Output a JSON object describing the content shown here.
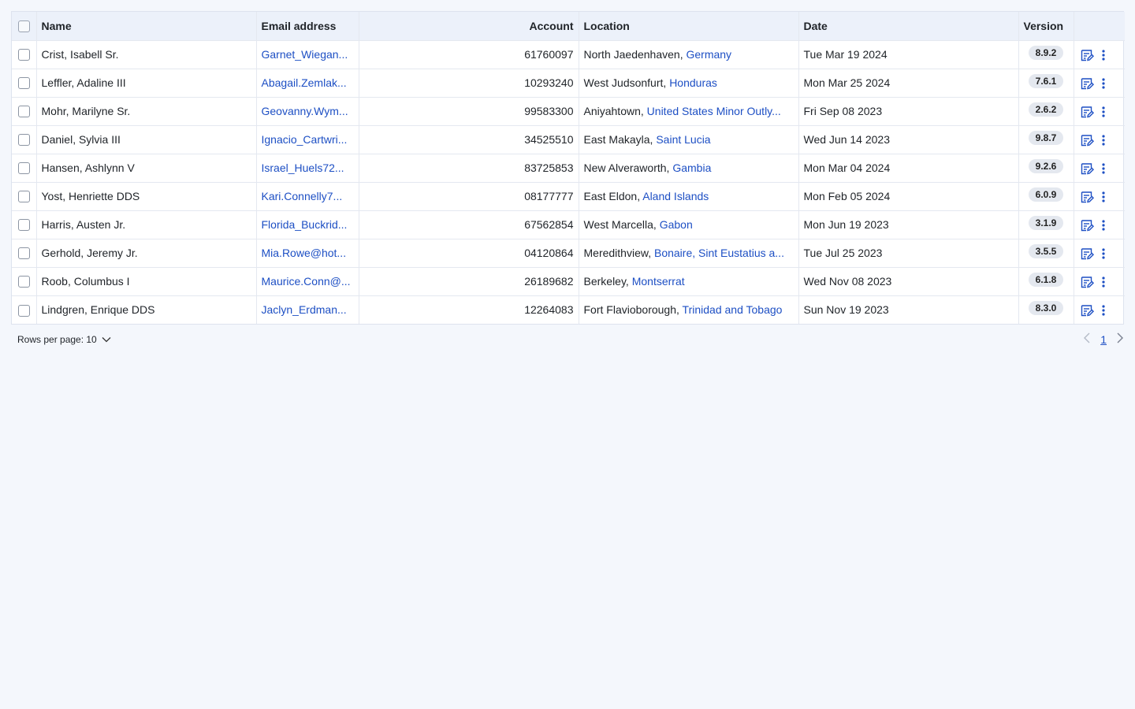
{
  "table": {
    "headers": {
      "name": "Name",
      "email": "Email address",
      "account": "Account",
      "location": "Location",
      "date": "Date",
      "version": "Version"
    },
    "rows": [
      {
        "name": "Crist, Isabell Sr.",
        "email": "Garnet_Wiegan...",
        "account": "61760097",
        "city": "North Jaedenhaven,",
        "country": "Germany",
        "date": "Tue Mar 19 2024",
        "version": "8.9.2"
      },
      {
        "name": "Leffler, Adaline III",
        "email": "Abagail.Zemlak...",
        "account": "10293240",
        "city": "West Judsonfurt,",
        "country": "Honduras",
        "date": "Mon Mar 25 2024",
        "version": "7.6.1"
      },
      {
        "name": "Mohr, Marilyne Sr.",
        "email": "Geovanny.Wym...",
        "account": "99583300",
        "city": "Aniyahtown,",
        "country": "United States Minor Outly...",
        "date": "Fri Sep 08 2023",
        "version": "2.6.2"
      },
      {
        "name": "Daniel, Sylvia III",
        "email": "Ignacio_Cartwri...",
        "account": "34525510",
        "city": "East Makayla,",
        "country": "Saint Lucia",
        "date": "Wed Jun 14 2023",
        "version": "9.8.7"
      },
      {
        "name": "Hansen, Ashlynn V",
        "email": "Israel_Huels72...",
        "account": "83725853",
        "city": "New Alveraworth,",
        "country": "Gambia",
        "date": "Mon Mar 04 2024",
        "version": "9.2.6"
      },
      {
        "name": "Yost, Henriette DDS",
        "email": "Kari.Connelly7...",
        "account": "08177777",
        "city": "East Eldon,",
        "country": "Aland Islands",
        "date": "Mon Feb 05 2024",
        "version": "6.0.9"
      },
      {
        "name": "Harris, Austen Jr.",
        "email": "Florida_Buckrid...",
        "account": "67562854",
        "city": "West Marcella,",
        "country": "Gabon",
        "date": "Mon Jun 19 2023",
        "version": "3.1.9"
      },
      {
        "name": "Gerhold, Jeremy Jr.",
        "email": "Mia.Rowe@hot...",
        "account": "04120864",
        "city": "Meredithview,",
        "country": "Bonaire, Sint Eustatius a...",
        "date": "Tue Jul 25 2023",
        "version": "3.5.5"
      },
      {
        "name": "Roob, Columbus I",
        "email": "Maurice.Conn@...",
        "account": "26189682",
        "city": "Berkeley,",
        "country": "Montserrat",
        "date": "Wed Nov 08 2023",
        "version": "6.1.8"
      },
      {
        "name": "Lindgren, Enrique DDS",
        "email": "Jaclyn_Erdman...",
        "account": "12264083",
        "city": "Fort Flavioborough,",
        "country": "Trinidad and Tobago",
        "date": "Sun Nov 19 2023",
        "version": "8.3.0"
      }
    ]
  },
  "footer": {
    "rows_per_page": "Rows per page: 10",
    "current_page": "1"
  },
  "icons": {
    "edit": "edit-list-icon",
    "more": "more-vertical-icon",
    "dropdown": "chevron-down-icon",
    "prev": "chevron-left-icon",
    "next": "chevron-right-icon"
  },
  "colors": {
    "link": "#1d4fc4",
    "header_bg": "#ecf1fa",
    "page_bg": "#f4f7fc"
  }
}
